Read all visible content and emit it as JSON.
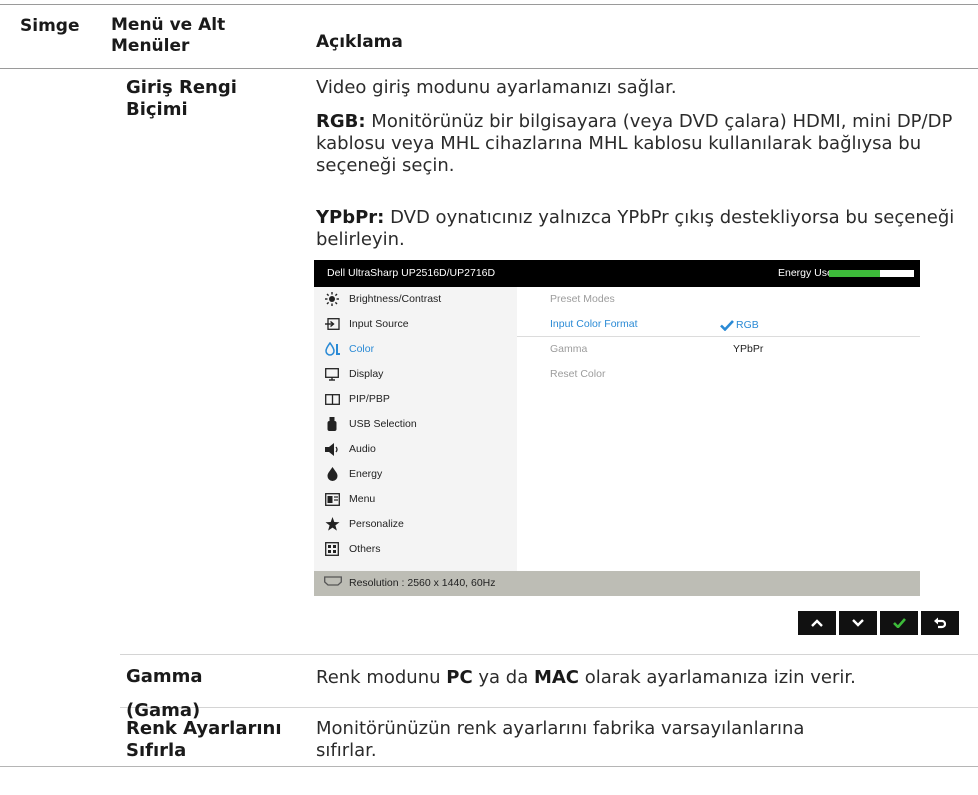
{
  "header": {
    "col_icon": "Simge",
    "col_menu": "Menü ve Alt Menüler",
    "col_desc": "Açıklama"
  },
  "rows": [
    {
      "title": "Giriş Rengi Biçimi",
      "intro": "Video giriş modunu ayarlamanızı sağlar.",
      "rgb_term": "RGB:",
      "rgb_text": " Monitörünüz bir bilgisayara (veya DVD çalara) HDMI, mini DP/DP kablosu veya MHL cihazlarına MHL kablosu kullanılarak bağlıysa bu seçeneği seçin.",
      "ypbpr_term": "YPbPr:",
      "ypbpr_text": " DVD oynatıcınız yalnızca YPbPr çıkış destekliyorsa bu seçeneği belirleyin."
    },
    {
      "title_line1": "Gamma",
      "title_line2": "(Gama)",
      "desc_pre": "Renk modunu ",
      "desc_pc": "PC",
      "desc_mid": " ya da ",
      "desc_mac": "MAC",
      "desc_post": " olarak ayarlamanıza izin verir."
    },
    {
      "title": "Renk Ayarlarını Sıfırla",
      "desc": "Monitörünüzün renk ayarlarını fabrika varsayılanlarına sıfırlar."
    }
  ],
  "osd": {
    "title": "Dell UltraSharp UP2516D/UP2716D",
    "energy_label": "Energy Use",
    "energy_level": 0.6,
    "menu": [
      {
        "label": "Brightness/Contrast",
        "icon": "brightness-icon"
      },
      {
        "label": "Input Source",
        "icon": "input-source-icon"
      },
      {
        "label": "Color",
        "icon": "color-icon",
        "active": true
      },
      {
        "label": "Display",
        "icon": "display-icon"
      },
      {
        "label": "PIP/PBP",
        "icon": "pip-icon"
      },
      {
        "label": "USB Selection",
        "icon": "usb-icon"
      },
      {
        "label": "Audio",
        "icon": "audio-icon"
      },
      {
        "label": "Energy",
        "icon": "energy-icon"
      },
      {
        "label": "Menu",
        "icon": "menu-icon"
      },
      {
        "label": "Personalize",
        "icon": "star-icon"
      },
      {
        "label": "Others",
        "icon": "others-icon"
      }
    ],
    "submenu": [
      "Preset Modes",
      "Input Color Format",
      "Gamma",
      "Reset Color"
    ],
    "options": [
      "RGB",
      "YPbPr"
    ],
    "status": "Resolution : 2560 x 1440, 60Hz",
    "nav_icons": [
      "up-arrow-icon",
      "down-arrow-icon",
      "check-icon",
      "back-icon"
    ],
    "accent": "#2a8ad5",
    "energy_color": "#3dbb3a"
  }
}
